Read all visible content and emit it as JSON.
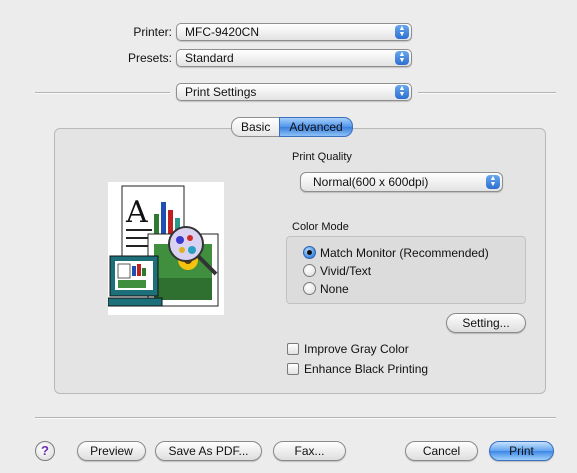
{
  "printer": {
    "label": "Printer:",
    "value": "MFC-9420CN"
  },
  "presets": {
    "label": "Presets:",
    "value": "Standard"
  },
  "panel_select": {
    "value": "Print Settings"
  },
  "tabs": [
    {
      "label": "Basic",
      "selected": false
    },
    {
      "label": "Advanced",
      "selected": true
    }
  ],
  "print_quality": {
    "label": "Print Quality",
    "value": "Normal(600 x 600dpi)"
  },
  "color_mode": {
    "label": "Color Mode",
    "options": [
      {
        "label": "Match Monitor (Recommended)",
        "selected": true
      },
      {
        "label": "Vivid/Text",
        "selected": false
      },
      {
        "label": "None",
        "selected": false
      }
    ]
  },
  "setting_button": "Setting...",
  "checkboxes": [
    {
      "label": "Improve Gray Color",
      "checked": false
    },
    {
      "label": "Enhance Black Printing",
      "checked": false
    }
  ],
  "footer": {
    "help": "?",
    "preview": "Preview",
    "save_pdf": "Save As PDF...",
    "fax": "Fax...",
    "cancel": "Cancel",
    "print": "Print"
  },
  "colors": {
    "accent": "#3e86e6",
    "window_bg": "#ececec",
    "pane_bg": "#e4e4e4"
  },
  "illustration": {
    "letter": "A"
  }
}
